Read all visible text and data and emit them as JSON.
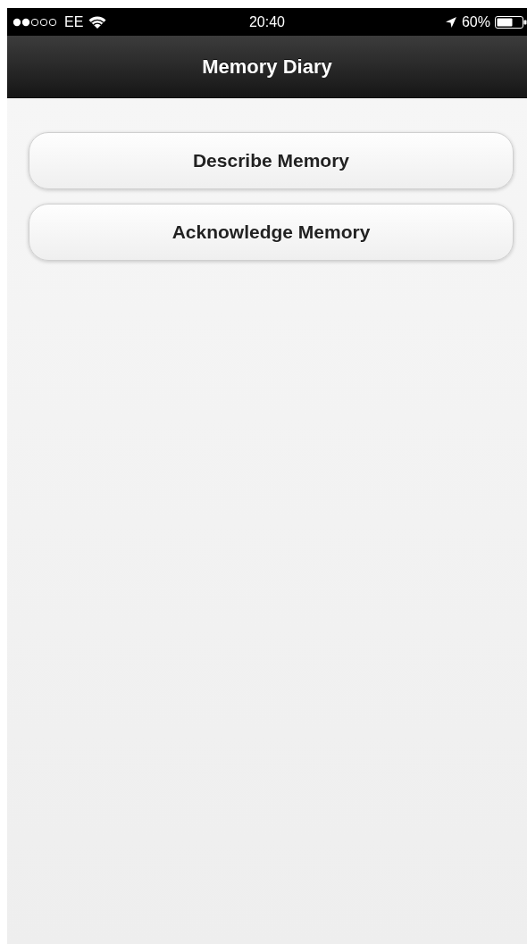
{
  "status_bar": {
    "carrier": "EE",
    "time": "20:40",
    "battery": "60%"
  },
  "nav_bar": {
    "title": "Memory Diary"
  },
  "buttons": [
    {
      "label": "Describe Memory"
    },
    {
      "label": "Acknowledge Memory"
    }
  ]
}
